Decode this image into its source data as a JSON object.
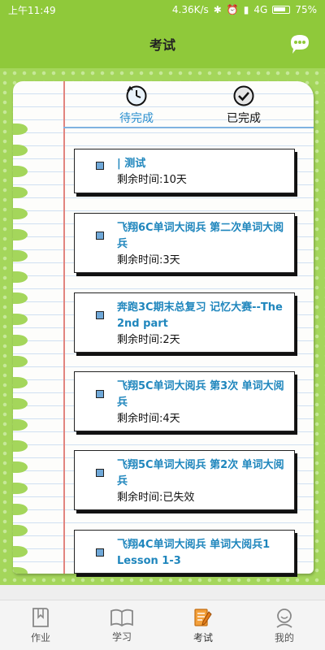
{
  "status": {
    "time": "上午11:49",
    "speed": "4.36K/s",
    "network": "4G",
    "battery": "75%"
  },
  "header": {
    "title": "考试",
    "chat_icon": "chat-bubble-icon",
    "accent_color": "#8fc93a"
  },
  "tabs": [
    {
      "label": "待完成",
      "icon": "clock-icon",
      "active": true,
      "color": "#2a8fcf"
    },
    {
      "label": "已完成",
      "icon": "check-circle-icon",
      "active": false,
      "color": "#111111"
    }
  ],
  "exams": [
    {
      "name": "| 测试",
      "remaining": "剩余时间:10天"
    },
    {
      "name": "飞翔6C单词大阅兵 第二次单词大阅兵",
      "remaining": "剩余时间:3天"
    },
    {
      "name": "奔跑3C期末总复习 记忆大赛--The 2nd part",
      "remaining": "剩余时间:2天"
    },
    {
      "name": "飞翔5C单词大阅兵 第3次 单词大阅兵",
      "remaining": "剩余时间:4天"
    },
    {
      "name": "飞翔5C单词大阅兵 第2次 单词大阅兵",
      "remaining": "剩余时间:已失效"
    },
    {
      "name": "飞翔4C单词大阅兵 单词大阅兵1 Lesson 1-3",
      "remaining": ""
    }
  ],
  "nav": [
    {
      "label": "作业",
      "icon": "bookmark-book-icon",
      "active": false
    },
    {
      "label": "学习",
      "icon": "open-book-icon",
      "active": false
    },
    {
      "label": "考试",
      "icon": "exam-paper-pencil-icon",
      "active": true
    },
    {
      "label": "我的",
      "icon": "person-icon",
      "active": false
    }
  ]
}
